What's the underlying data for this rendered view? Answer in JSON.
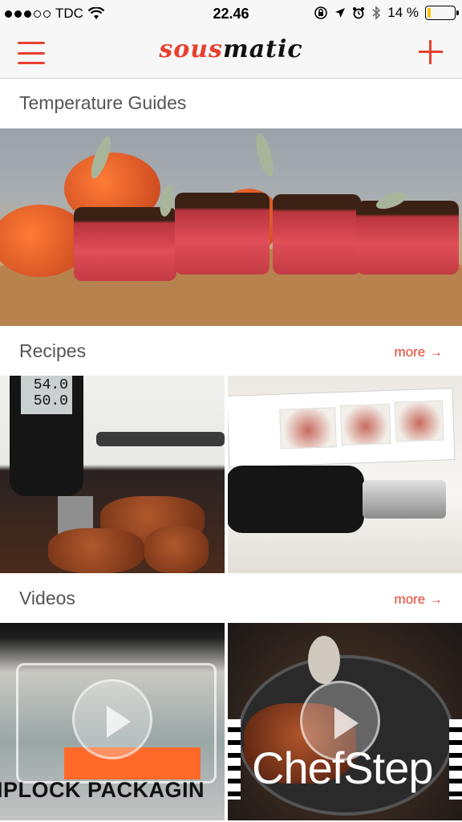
{
  "status_bar": {
    "carrier": "TDC",
    "time": "22.46",
    "battery": "14 %",
    "battery_level": 0.14
  },
  "nav": {
    "logo_part1": "sous",
    "logo_part2": "matic"
  },
  "sections": {
    "temperature": {
      "title": "Temperature Guides"
    },
    "recipes": {
      "title": "Recipes",
      "more": "more →"
    },
    "videos": {
      "title": "Videos",
      "more": "more →"
    }
  },
  "recipes": {
    "items": [
      {
        "screen_top": "54.0",
        "screen_bottom": "50.0"
      },
      {}
    ]
  },
  "videos": {
    "items": [
      {
        "caption": "IPLOCK PACKAGIN"
      },
      {
        "caption": "ChefStep"
      }
    ]
  },
  "colors": {
    "accent": "#e8402f",
    "nav_bg": "#f7f7f7"
  },
  "icons": [
    "wifi-icon",
    "lock-rotation-icon",
    "location-arrow-icon",
    "alarm-icon",
    "bluetooth-icon",
    "battery-icon",
    "menu-icon",
    "add-icon",
    "play-icon"
  ]
}
